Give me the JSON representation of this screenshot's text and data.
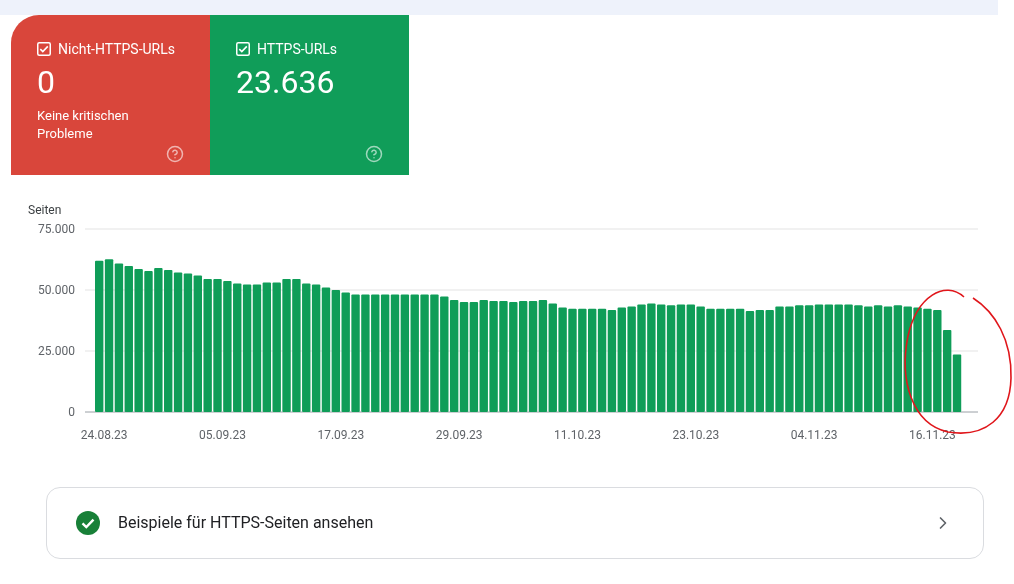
{
  "tiles": [
    {
      "kind": "error",
      "label": "Nicht-HTTPS-URLs",
      "checked": true,
      "value": "0",
      "caption": "Keine kritischen Probleme"
    },
    {
      "kind": "ok",
      "label": "HTTPS-URLs",
      "checked": true,
      "value": "23.636"
    }
  ],
  "chart": {
    "chart_data": {
      "type": "bar",
      "ylabel": "Seiten",
      "categories": [
        "24.08.23",
        null,
        null,
        null,
        null,
        null,
        null,
        null,
        null,
        null,
        null,
        null,
        "05.09.23",
        null,
        null,
        null,
        null,
        null,
        null,
        null,
        null,
        null,
        null,
        null,
        "17.09.23",
        null,
        null,
        null,
        null,
        null,
        null,
        null,
        null,
        null,
        null,
        null,
        "29.09.23",
        null,
        null,
        null,
        null,
        null,
        null,
        null,
        null,
        null,
        null,
        null,
        "11.10.23",
        null,
        null,
        null,
        null,
        null,
        null,
        null,
        null,
        null,
        null,
        null,
        "23.10.23",
        null,
        null,
        null,
        null,
        null,
        null,
        null,
        null,
        null,
        null,
        null,
        "04.11.23",
        null,
        null,
        null,
        null,
        null,
        null,
        null,
        null,
        null,
        null,
        null,
        "16.11.23",
        null,
        null,
        null
      ],
      "values": [
        62000,
        62600,
        60900,
        59800,
        58600,
        57800,
        59000,
        58200,
        57200,
        56800,
        55900,
        54500,
        54500,
        53700,
        52700,
        52300,
        52300,
        53100,
        53100,
        54500,
        54500,
        52700,
        52300,
        51000,
        50000,
        49000,
        48200,
        48200,
        48200,
        48200,
        48200,
        48200,
        48200,
        48200,
        48200,
        47300,
        45900,
        45100,
        45100,
        45900,
        45500,
        45500,
        45100,
        45500,
        45500,
        45900,
        44500,
        42800,
        42300,
        42300,
        42300,
        42300,
        41800,
        42800,
        43200,
        44100,
        44500,
        44100,
        43700,
        44100,
        44100,
        43200,
        42300,
        42300,
        42300,
        42300,
        41400,
        41800,
        41800,
        43200,
        43200,
        43700,
        43700,
        44100,
        44100,
        44100,
        44100,
        43700,
        43200,
        43700,
        43200,
        43700,
        43200,
        42800,
        42300,
        41800,
        33600,
        23600
      ],
      "ylim": [
        0,
        75000
      ],
      "yticks": [
        {
          "value": 0,
          "label": "0"
        },
        {
          "value": 25000,
          "label": "25.000"
        },
        {
          "value": 50000,
          "label": "50.000"
        },
        {
          "value": 75000,
          "label": "75.000"
        }
      ]
    }
  },
  "examples_link": {
    "label": "Beispiele für HTTPS-Seiten ansehen"
  }
}
